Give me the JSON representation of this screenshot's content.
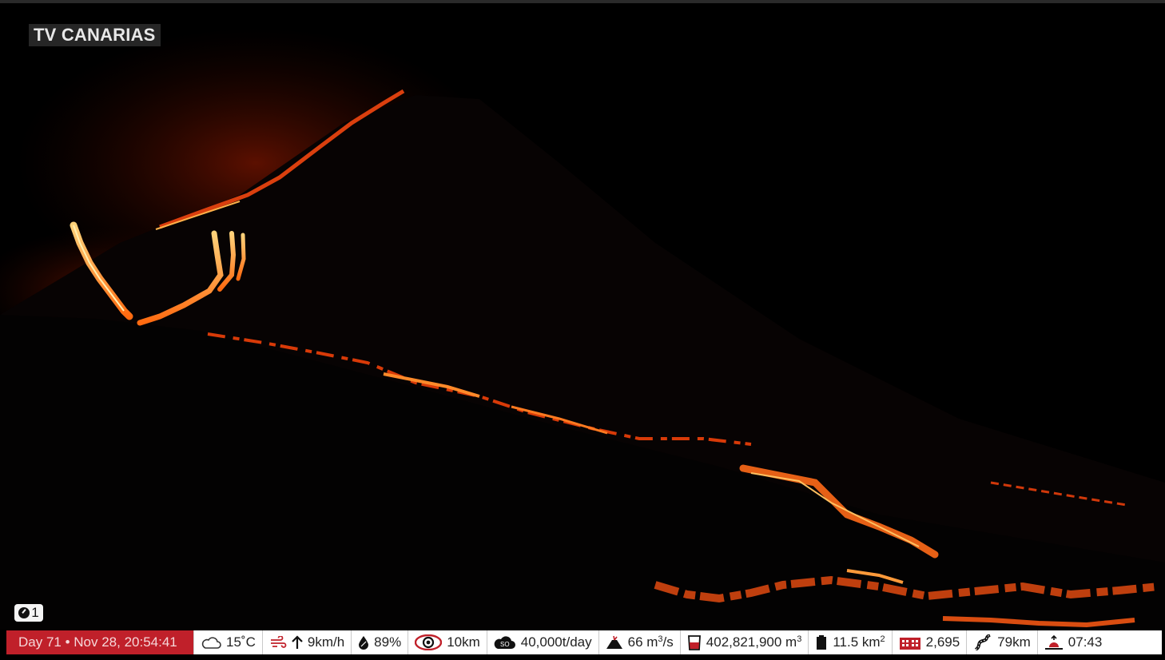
{
  "overlay": {
    "channel_logo": "TV CANARIAS",
    "camera_number": "1"
  },
  "status_bar": {
    "date": "Day 71 • Nov 28, 20:54:41",
    "temperature": "15˚C",
    "wind": "9km/h",
    "humidity": "89%",
    "visibility": "10km",
    "so2": "40,000t/day",
    "flow": "66 m",
    "flow_sup": "3",
    "flow_unit": "/s",
    "volume": "402,821,900 m",
    "volume_sup": "3",
    "area": "11.5 km",
    "area_sup": "2",
    "buildings": "2,695",
    "roads": "79km",
    "sunrise": "07:43"
  },
  "icons": {
    "weather": "cloud-icon",
    "wind": "wind-icon",
    "wind_direction": "arrow-up-icon",
    "humidity": "droplet-icon",
    "visibility": "eye-icon",
    "so2": "so2-cloud-icon",
    "flow": "volcano-icon",
    "volume": "beaker-icon",
    "area": "area-icon",
    "buildings": "building-icon",
    "roads": "road-icon",
    "sunrise": "sunrise-icon",
    "camera": "camera-dial-icon"
  },
  "colors": {
    "date_bg": "#c0202a",
    "icon_red": "#c0202a",
    "lava": "#ff5a00"
  }
}
